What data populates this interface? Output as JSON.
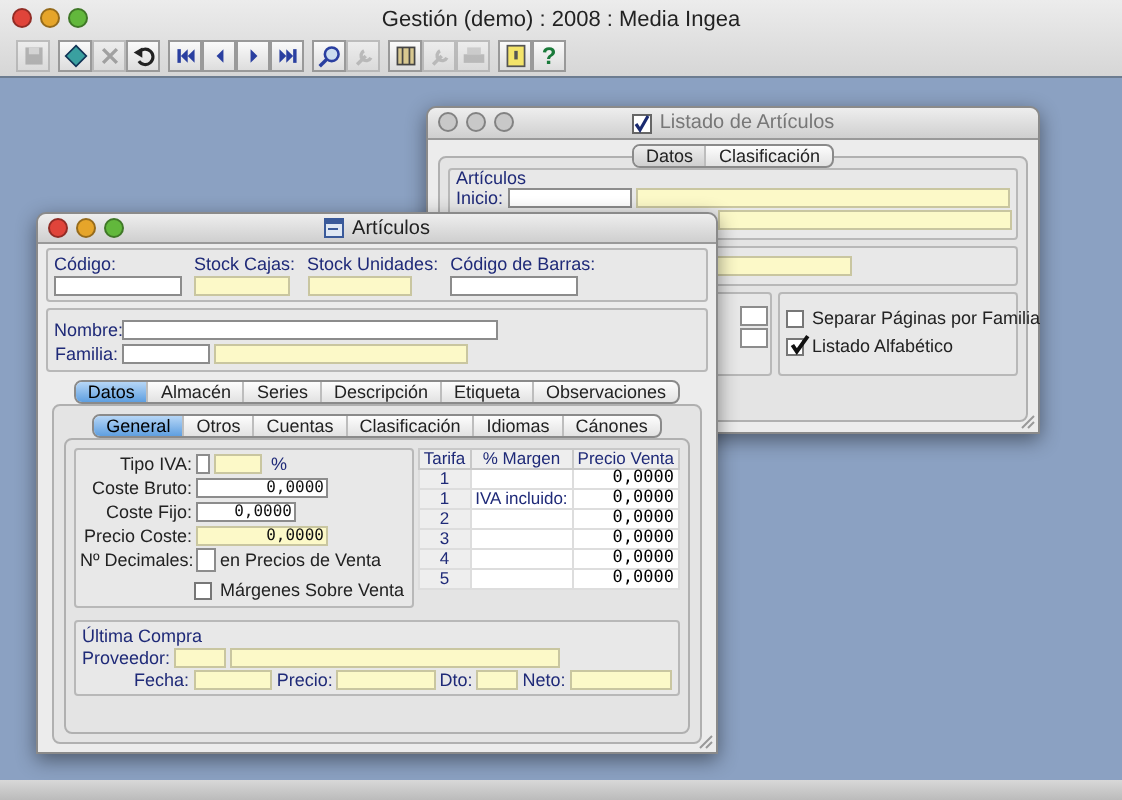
{
  "app_window": {
    "title": "Gestión (demo) : 2008 : Media Ingea"
  },
  "toolbar": [
    [
      {
        "kind": "save",
        "disabled": true
      }
    ],
    [
      {
        "kind": "clear",
        "disabled": false
      },
      {
        "kind": "delete",
        "disabled": true
      },
      {
        "kind": "undo",
        "disabled": false
      }
    ],
    [
      {
        "kind": "first",
        "disabled": false
      },
      {
        "kind": "prev",
        "disabled": false
      },
      {
        "kind": "next",
        "disabled": false
      },
      {
        "kind": "last",
        "disabled": false
      }
    ],
    [
      {
        "kind": "search",
        "disabled": false
      },
      {
        "kind": "tool",
        "disabled": true
      }
    ],
    [
      {
        "kind": "book",
        "disabled": false
      },
      {
        "kind": "tool",
        "disabled": true
      },
      {
        "kind": "print",
        "disabled": true
      }
    ],
    [
      {
        "kind": "note",
        "disabled": false
      },
      {
        "kind": "help",
        "disabled": false,
        "label": "?"
      }
    ]
  ],
  "listado_window": {
    "title": "Listado de Artículos",
    "active": false,
    "tabs": [
      {
        "label": "Datos",
        "selected": true
      },
      {
        "label": "Clasificación",
        "selected": false
      }
    ],
    "group_title": "Artículos",
    "inicio_label": "Inicio:",
    "checkboxes": [
      {
        "label": "Separar Páginas por Familia",
        "checked": false
      },
      {
        "label": "Listado Alfabético",
        "checked": true
      }
    ]
  },
  "articulos_window": {
    "title": "Artículos",
    "active": true,
    "header_fields": [
      {
        "label": "Código:",
        "readonly": false
      },
      {
        "label": "Stock Cajas:",
        "readonly": true
      },
      {
        "label": "Stock Unidades:",
        "readonly": true
      },
      {
        "label": "Código de Barras:",
        "readonly": false
      }
    ],
    "nombre_label": "Nombre:",
    "familia_label": "Familia:",
    "tabs": [
      {
        "label": "Datos",
        "selected": true
      },
      {
        "label": "Almacén",
        "selected": false
      },
      {
        "label": "Series",
        "selected": false
      },
      {
        "label": "Descripción",
        "selected": false
      },
      {
        "label": "Etiqueta",
        "selected": false
      },
      {
        "label": "Observaciones",
        "selected": false
      }
    ],
    "subtabs": [
      {
        "label": "General",
        "selected": true
      },
      {
        "label": "Otros",
        "selected": false
      },
      {
        "label": "Cuentas",
        "selected": false
      },
      {
        "label": "Clasificación",
        "selected": false
      },
      {
        "label": "Idiomas",
        "selected": false
      },
      {
        "label": "Cánones",
        "selected": false
      }
    ],
    "tipo_iva": {
      "label": "Tipo IVA:",
      "unit": "%"
    },
    "costs": [
      {
        "label": "Coste Bruto:",
        "value": "0,0000",
        "readonly": false
      },
      {
        "label": "Coste Fijo:",
        "value": "0,0000",
        "readonly": false
      },
      {
        "label": "Precio Coste:",
        "value": "0,0000",
        "readonly": true
      }
    ],
    "decimales": {
      "label": "Nº Decimales:",
      "suffix": "en Precios de Venta"
    },
    "margenes_checkbox": {
      "label": "Márgenes Sobre Venta",
      "checked": false
    },
    "table": {
      "columns": [
        "Tarifa",
        "% Margen",
        "Precio Venta"
      ],
      "rows": [
        {
          "tarifa": "1",
          "precio": "0,0000"
        },
        {
          "tarifa": "1",
          "margen": "IVA incluido:",
          "precio": "0,0000"
        },
        {
          "tarifa": "2",
          "precio": "0,0000"
        },
        {
          "tarifa": "3",
          "precio": "0,0000"
        },
        {
          "tarifa": "4",
          "precio": "0,0000"
        },
        {
          "tarifa": "5",
          "precio": "0,0000"
        }
      ]
    },
    "ultima_compra": {
      "title": "Última Compra",
      "proveedor_label": "Proveedor:",
      "fecha_label": "Fecha:",
      "precio_label": "Precio:",
      "dto_label": "Dto:",
      "neto_label": "Neto:"
    }
  }
}
